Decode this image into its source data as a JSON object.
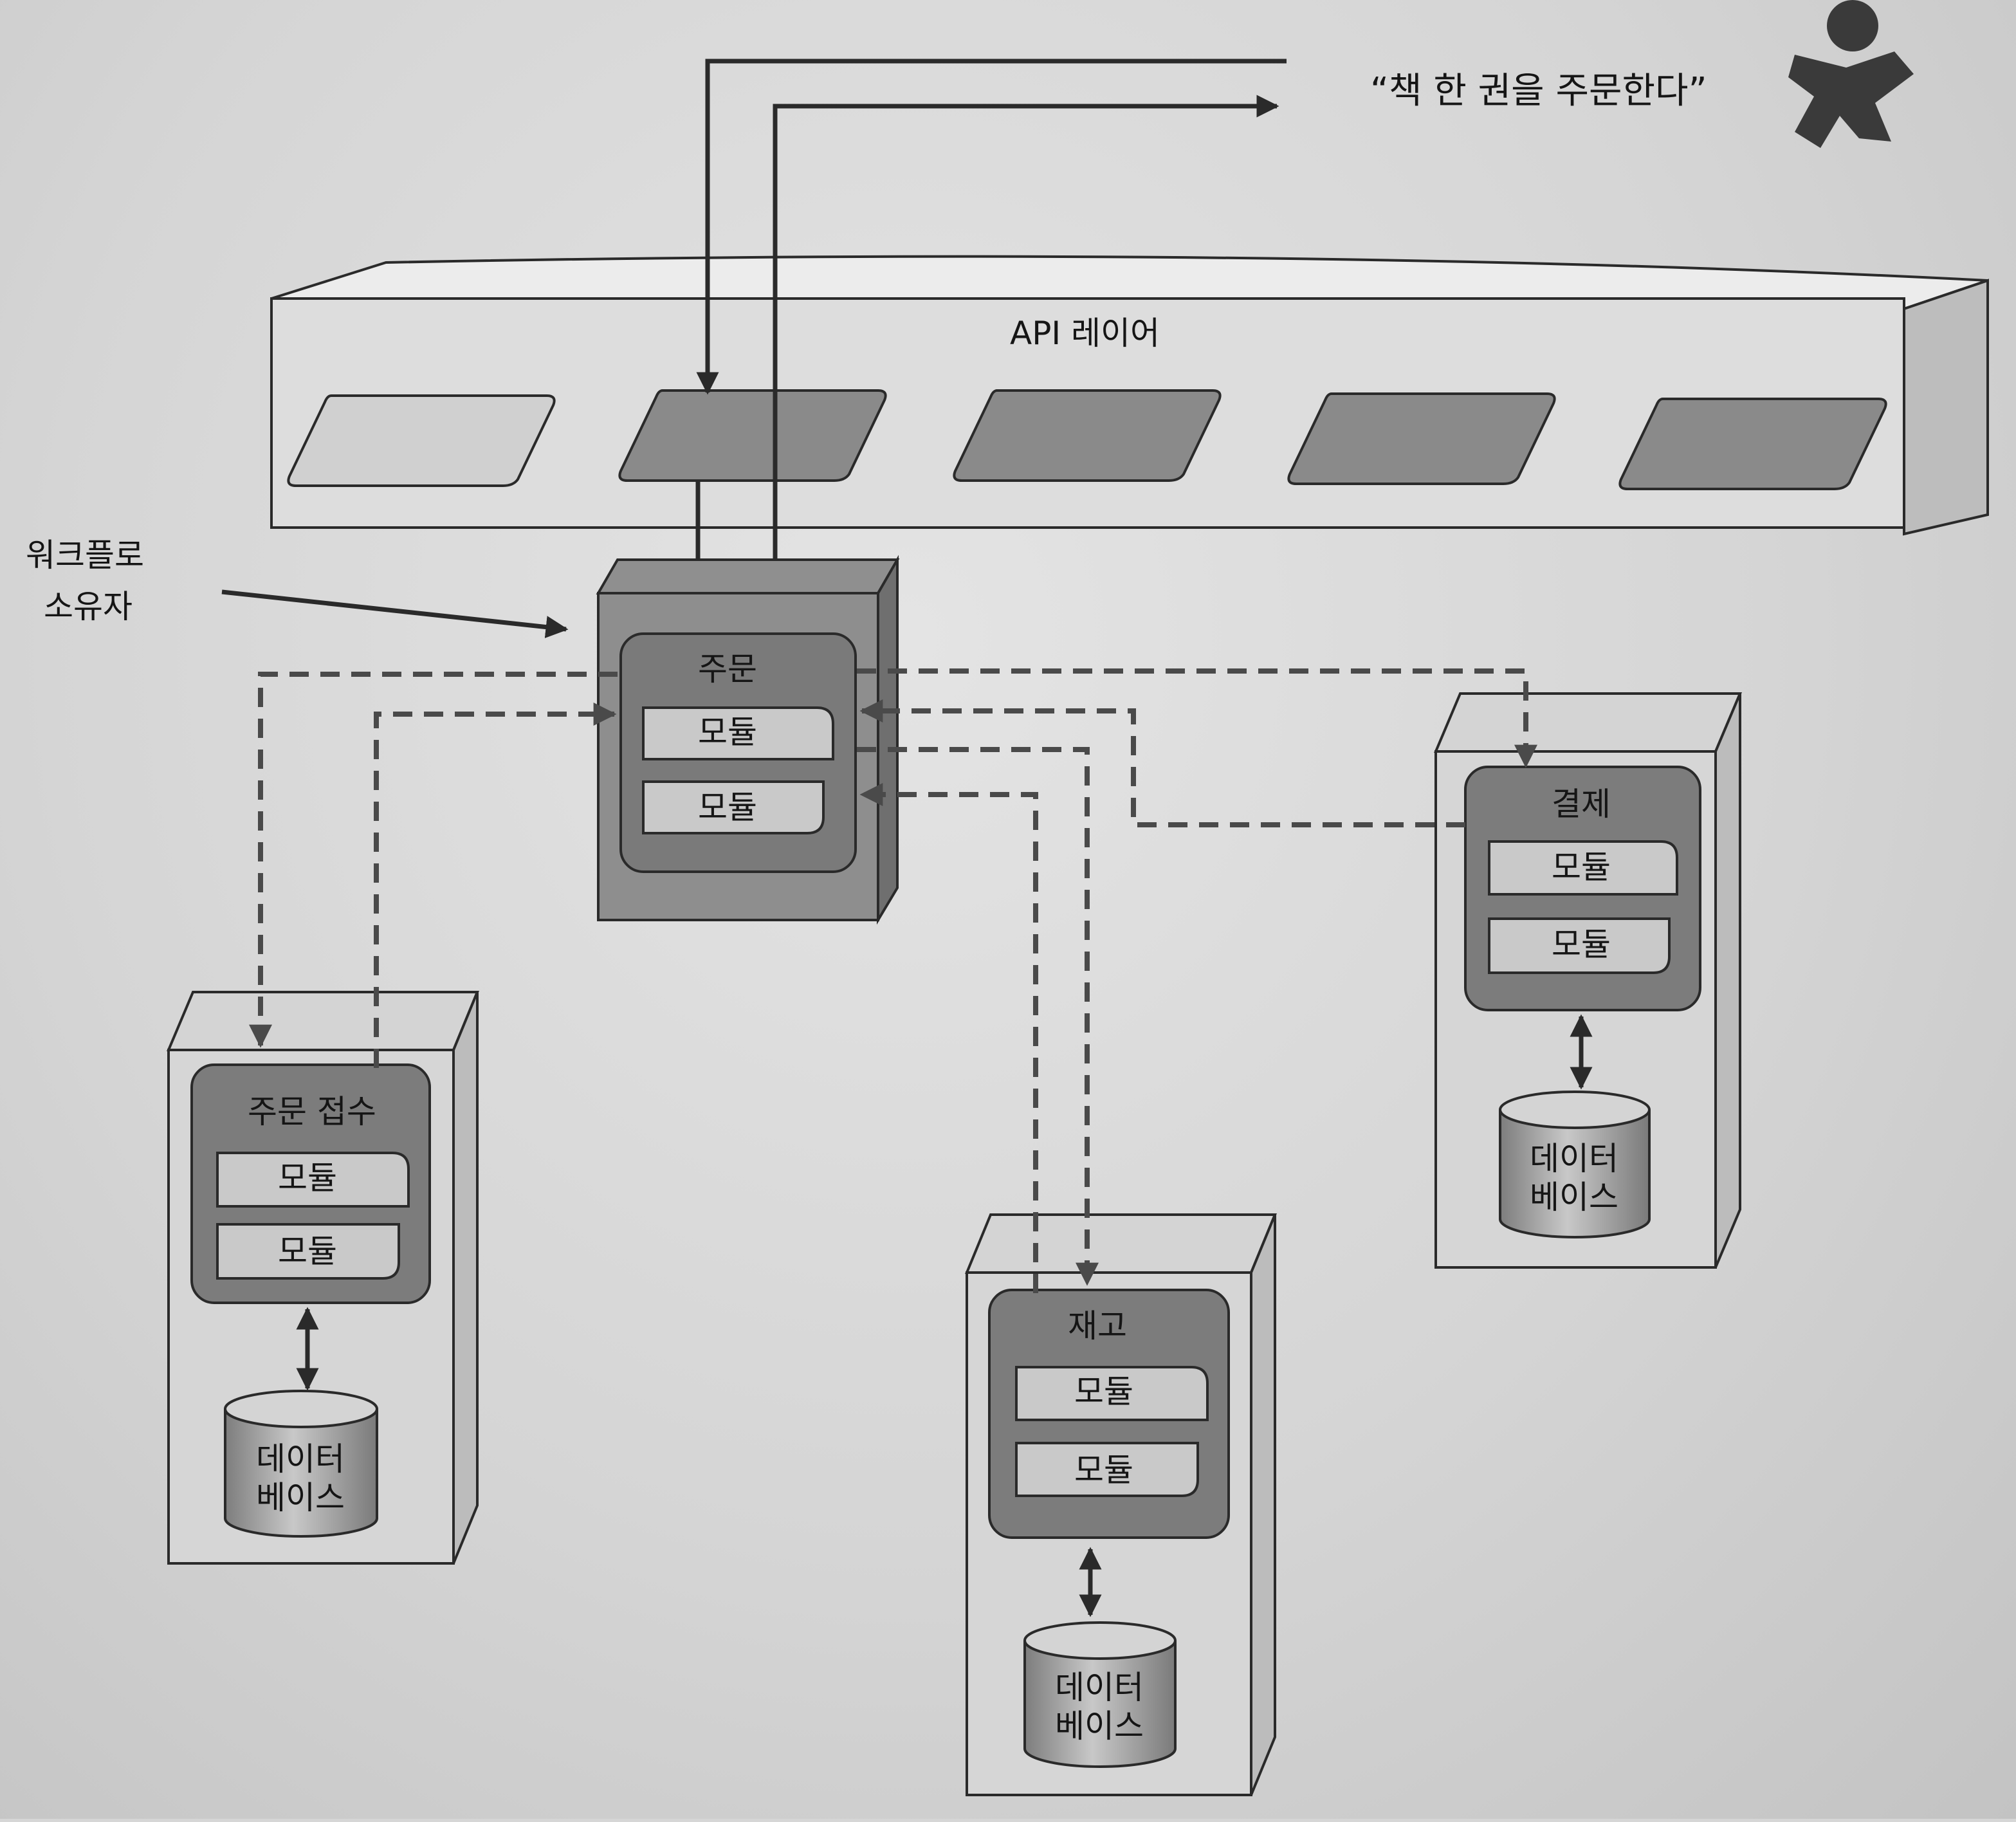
{
  "quote": "“책 한 권을 주문한다”",
  "api_layer": {
    "label": "API 레이어",
    "endpoint_count": 5
  },
  "workflow_owner": {
    "line1": "워크플로",
    "line2": "소유자"
  },
  "services": {
    "order": {
      "title": "주문",
      "modules": [
        "모듈",
        "모듈"
      ]
    },
    "order_intake": {
      "title": "주문 접수",
      "modules": [
        "모듈",
        "모듈"
      ],
      "database": {
        "line1": "데이터",
        "line2": "베이스"
      }
    },
    "inventory": {
      "title": "재고",
      "modules": [
        "모듈",
        "모듈"
      ],
      "database": {
        "line1": "데이터",
        "line2": "베이스"
      }
    },
    "payment": {
      "title": "결제",
      "modules": [
        "모듈",
        "모듈"
      ],
      "database": {
        "line1": "데이터",
        "line2": "베이스"
      }
    }
  },
  "colors": {
    "ink": "#2a2a2a",
    "box_light": "#d9d9d9",
    "box_mid": "#9a9a9a",
    "box_dark": "#707070",
    "module_fill": "#8c8c8c",
    "endpoint": "#8a8a8a"
  }
}
